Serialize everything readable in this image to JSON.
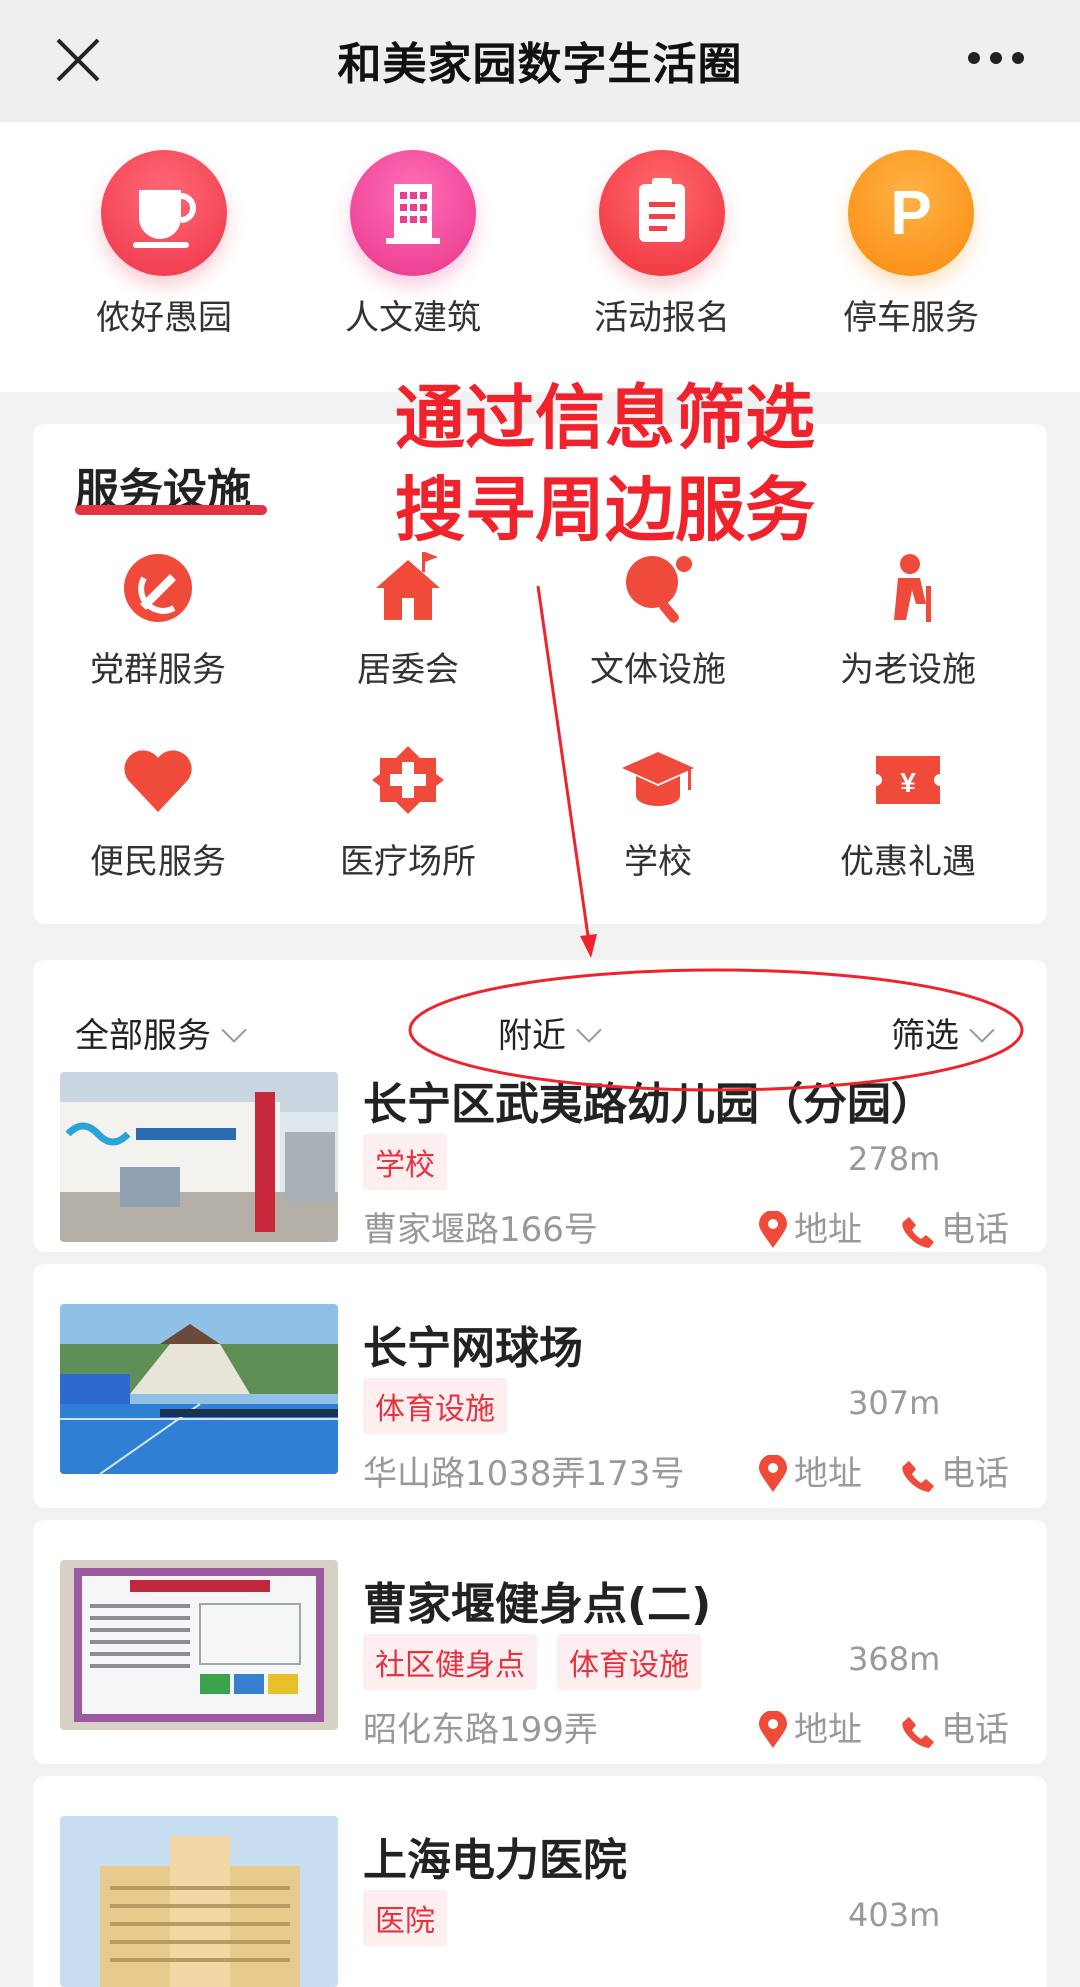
{
  "header": {
    "title": "和美家园数字生活圈"
  },
  "quick": [
    {
      "label": "侬好愚园",
      "icon": "cup-icon",
      "color": "#f0414e"
    },
    {
      "label": "人文建筑",
      "icon": "building-icon",
      "color": "#ec3d8f"
    },
    {
      "label": "活动报名",
      "icon": "clipboard-icon",
      "color": "#f24048"
    },
    {
      "label": "停车服务",
      "icon": "parking-icon",
      "color": "#fb8f16"
    }
  ],
  "annotation": {
    "line1": "通过信息筛选",
    "line2": "搜寻周边服务"
  },
  "services": {
    "heading": "服务设施",
    "items": [
      {
        "label": "党群服务",
        "icon": "party-emblem-icon"
      },
      {
        "label": "居委会",
        "icon": "house-flag-icon"
      },
      {
        "label": "文体设施",
        "icon": "ping-pong-icon"
      },
      {
        "label": "为老设施",
        "icon": "elderly-icon"
      },
      {
        "label": "便民服务",
        "icon": "heart-icon"
      },
      {
        "label": "医疗场所",
        "icon": "medical-cross-icon"
      },
      {
        "label": "学校",
        "icon": "graduation-cap-icon"
      },
      {
        "label": "优惠礼遇",
        "icon": "coupon-yen-icon"
      }
    ]
  },
  "filter": {
    "all": "全部服务",
    "nearby": "附近",
    "filter": "筛选"
  },
  "listings": [
    {
      "name": "长宁区武夷路幼儿园（分园）",
      "tags": [
        "学校"
      ],
      "distance": "278m",
      "address": "曹家堰路166号",
      "addr_label": "地址",
      "phone_label": "电话"
    },
    {
      "name": "长宁网球场",
      "tags": [
        "体育设施"
      ],
      "distance": "307m",
      "address": "华山路1038弄173号",
      "addr_label": "地址",
      "phone_label": "电话"
    },
    {
      "name": "曹家堰健身点(二)",
      "tags": [
        "社区健身点",
        "体育设施"
      ],
      "distance": "368m",
      "address": "昭化东路199弄",
      "addr_label": "地址",
      "phone_label": "电话"
    },
    {
      "name": "上海电力医院",
      "tags": [
        "医院"
      ],
      "distance": "403m",
      "address": "",
      "addr_label": "",
      "phone_label": ""
    }
  ],
  "colors": {
    "accent": "#e4323e",
    "annotation": "#f0232c"
  }
}
